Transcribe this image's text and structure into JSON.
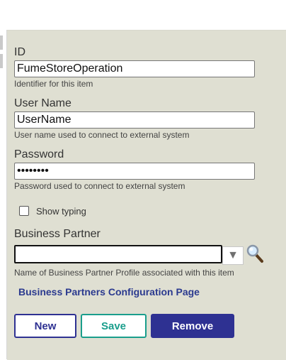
{
  "form": {
    "id": {
      "label": "ID",
      "value": "FumeStoreOperation",
      "help": "Identifier for this item"
    },
    "user_name": {
      "label": "User Name",
      "value": "UserName",
      "help": "User name used to connect to external system"
    },
    "password": {
      "label": "Password",
      "value": "••••••••",
      "help": "Password used to connect to external system"
    },
    "show_typing": {
      "label": "Show typing",
      "checked": false
    },
    "business_partner": {
      "label": "Business Partner",
      "selected": "",
      "help": "Name of Business Partner Profile associated with this item"
    },
    "link": "Business Partners Configuration Page"
  },
  "buttons": {
    "new": "New",
    "save": "Save",
    "remove": "Remove"
  },
  "colors": {
    "panel_background": "#dfdfd2",
    "primary": "#2e3192",
    "secondary": "#1a9e8c"
  }
}
